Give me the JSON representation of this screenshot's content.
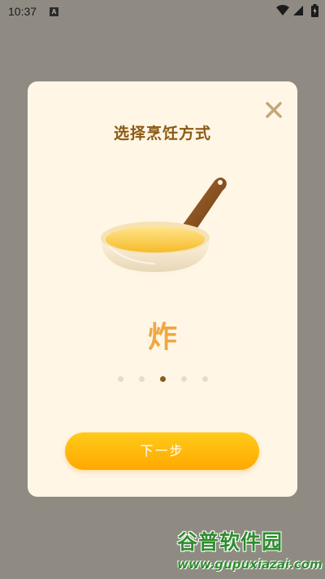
{
  "status_bar": {
    "time": "10:37",
    "a_icon_label": "A",
    "icons": [
      "a-icon",
      "wifi-icon",
      "signal-icon",
      "battery-icon"
    ]
  },
  "modal": {
    "title": "选择烹饪方式",
    "close_icon": "close-icon",
    "illustration": "frying-pan-icon",
    "method_name": "炸",
    "pagination": {
      "total": 5,
      "current": 3
    },
    "next_button_label": "下一步"
  },
  "watermark": {
    "text": "谷普软件园",
    "url": "www.gupuxiazai.com"
  },
  "colors": {
    "background_overlay": "#8f8b83",
    "modal_bg": "#fff6e6",
    "title": "#8b5a12",
    "method_name": "#f0a742",
    "button_start": "#ffcb1a",
    "button_end": "#ffa800",
    "dot_active": "#8a5c1c",
    "dot_inactive": "#e7dcc8"
  }
}
